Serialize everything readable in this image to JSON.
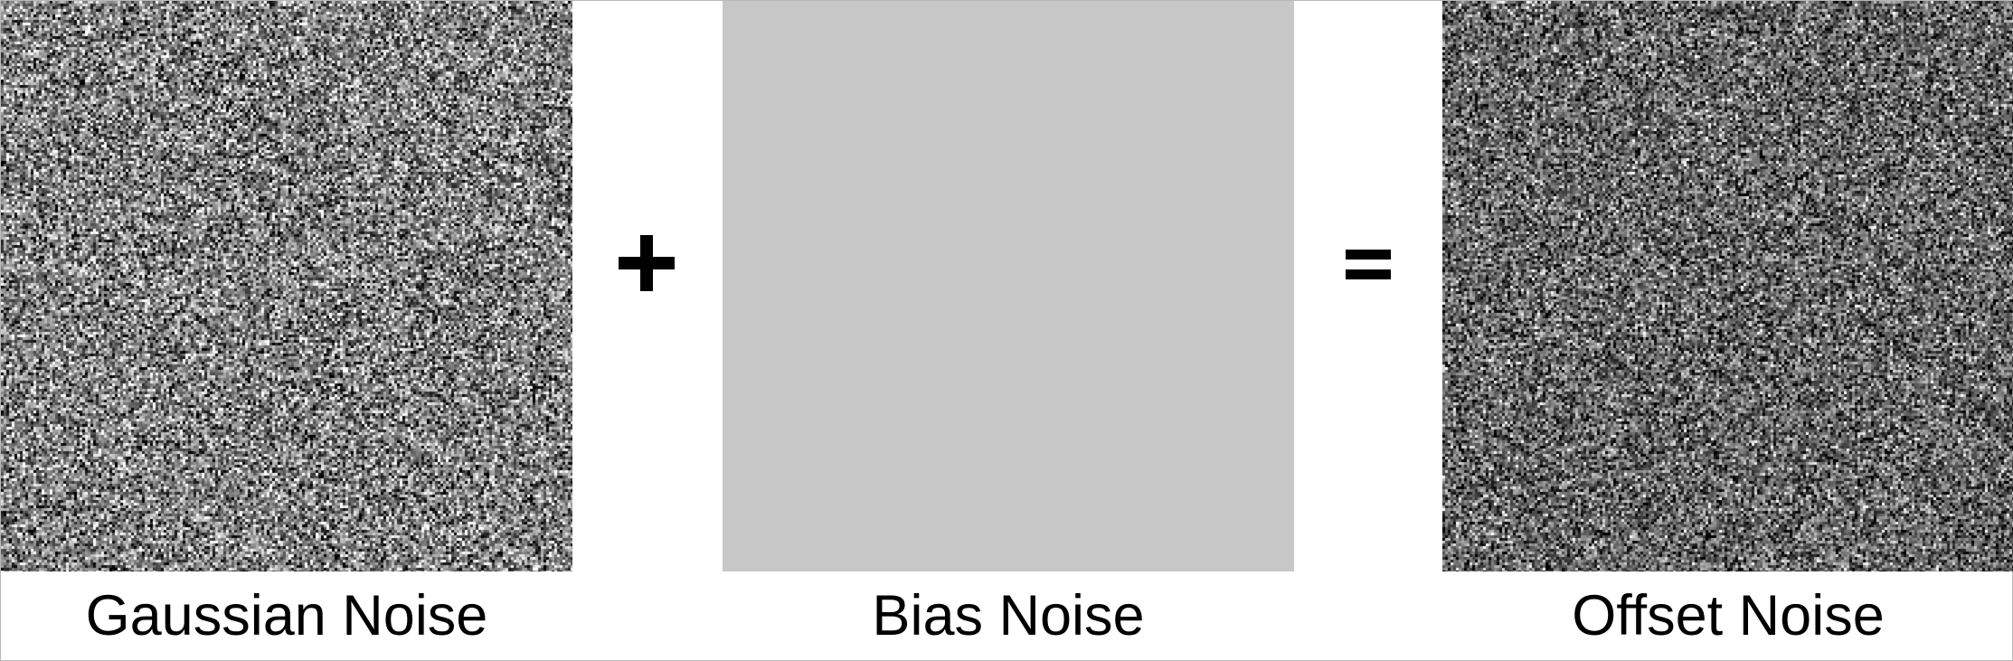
{
  "panels": [
    {
      "label": "Gaussian Noise",
      "kind": "noise",
      "mean_gray": 0.5,
      "contrast": 1.0
    },
    {
      "label": "Bias Noise",
      "kind": "solid",
      "color": "#c8c8c8"
    },
    {
      "label": "Offset Noise",
      "kind": "noise",
      "mean_gray": 0.4,
      "contrast": 0.85
    }
  ],
  "operators": {
    "plus": "+",
    "equals": "="
  },
  "colors": {
    "background": "#ffffff",
    "text": "#000000",
    "border": "#b8b8b8"
  }
}
